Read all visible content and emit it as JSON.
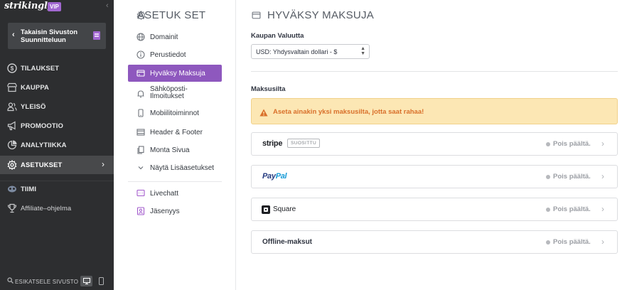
{
  "brand": {
    "logo": "strikingly",
    "badge": "VIP"
  },
  "back_button": {
    "label": "Takaisin Sivuston Suunnitteluun"
  },
  "sidebar": {
    "items": [
      {
        "label": "TILAUKSET",
        "icon": "dollar-circle-icon"
      },
      {
        "label": "KAUPPA",
        "icon": "store-icon"
      },
      {
        "label": "YLEISÖ",
        "icon": "users-icon"
      },
      {
        "label": "PROMOOTIO",
        "icon": "megaphone-icon"
      },
      {
        "label": "ANALYTIIKKA",
        "icon": "pie-chart-icon"
      },
      {
        "label": "ASETUKSET",
        "icon": "gear-icon",
        "active": true
      },
      {
        "label": "TIIMI",
        "icon": "team-icon"
      },
      {
        "label": "Affiliate–ohjelma",
        "icon": "trophy-icon"
      }
    ],
    "preview_label": "ESIKATSELE SIVUSTO"
  },
  "settings_nav": {
    "title": "ASETUK SET",
    "items": [
      {
        "label": "Domainit",
        "icon": "globe-icon"
      },
      {
        "label": "Perustiedot",
        "icon": "info-icon"
      },
      {
        "label": "Hyväksy Maksuja",
        "icon": "credit-card-icon",
        "active": true
      },
      {
        "label": "Sähköposti-Ilmoitukset",
        "label_line1": "Sähköposti-",
        "label_line2": "Ilmoitukset",
        "icon": "bell-icon"
      },
      {
        "label": "Mobiilitoiminnot",
        "icon": "mobile-icon"
      },
      {
        "label": "Header & Footer",
        "icon": "header-footer-icon"
      },
      {
        "label": "Monta Sivua",
        "icon": "pages-icon"
      },
      {
        "label": "Näytä Lisäasetukset",
        "icon": "chevron-down-icon"
      },
      {
        "label": "Livechatt",
        "icon": "chat-icon"
      },
      {
        "label": "Jäsenyys",
        "icon": "member-icon"
      }
    ]
  },
  "main": {
    "title": "HYVÄKSY MAKSUJA",
    "currency_label": "Kaupan Valuutta",
    "currency_value": "USD: Yhdysvaltain dollari - $",
    "gateways_label": "Maksusilta",
    "alert": "Aseta ainakin yksi maksusilta, jotta saat rahaa!",
    "providers": [
      {
        "name": "stripe",
        "badge": "SUOSITTU",
        "status": "Pois päältä."
      },
      {
        "name_part1": "Pay",
        "name_part2": "Pal",
        "status": "Pois päältä."
      },
      {
        "name": "Square",
        "status": "Pois päältä."
      },
      {
        "name": "Offline-maksut",
        "status": "Pois päältä."
      }
    ]
  },
  "colors": {
    "accent": "#8e58be",
    "sidebar_bg": "#2d2e30",
    "alert_bg": "#fce7b4",
    "alert_text": "#d9702b"
  }
}
